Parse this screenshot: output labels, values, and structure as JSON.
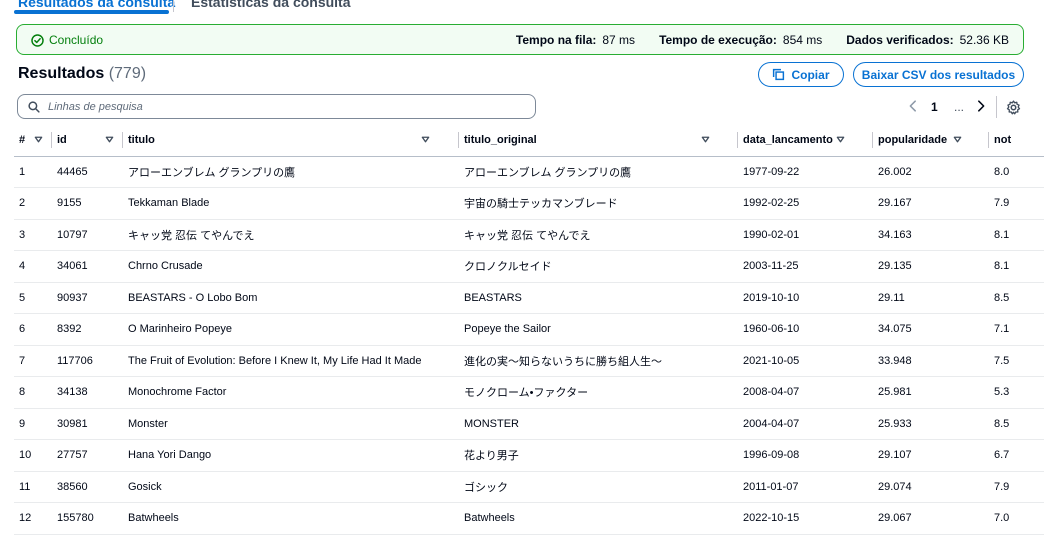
{
  "tabs": [
    {
      "label": "Resultados da consulta"
    },
    {
      "label": "Estatísticas da consulta"
    }
  ],
  "status": {
    "label": "Concluído",
    "queue_label": "Tempo na fila:",
    "queue_value": "87 ms",
    "exec_label": "Tempo de execução:",
    "exec_value": "854 ms",
    "data_label": "Dados verificados:",
    "data_value": "52.36 KB"
  },
  "results": {
    "title": "Resultados",
    "count": "(779)",
    "copy_label": "Copiar",
    "download_label": "Baixar CSV dos resultados"
  },
  "search": {
    "placeholder": "Linhas de pesquisa"
  },
  "pagination": {
    "current": "1",
    "ellipsis": "..."
  },
  "table": {
    "headers": [
      "#",
      "id",
      "titulo",
      "titulo_original",
      "data_lancamento",
      "popularidade",
      "not"
    ],
    "rows": [
      [
        "1",
        "44465",
        "アローエンブレム グランプリの鷹",
        "アローエンブレム グランプリの鷹",
        "1977-09-22",
        "26.002",
        "8.0"
      ],
      [
        "2",
        "9155",
        "Tekkaman Blade",
        "宇宙の騎士テッカマンブレード",
        "1992-02-25",
        "29.167",
        "7.9"
      ],
      [
        "3",
        "10797",
        "キャッ党 忍伝 てやんでえ",
        "キャッ党 忍伝 てやんでえ",
        "1990-02-01",
        "34.163",
        "8.1"
      ],
      [
        "4",
        "34061",
        "Chrno Crusade",
        "クロノクルセイド",
        "2003-11-25",
        "29.135",
        "8.1"
      ],
      [
        "5",
        "90937",
        "BEASTARS - O Lobo Bom",
        "BEASTARS",
        "2019-10-10",
        "29.11",
        "8.5"
      ],
      [
        "6",
        "8392",
        "O Marinheiro Popeye",
        "Popeye the Sailor",
        "1960-06-10",
        "34.075",
        "7.1"
      ],
      [
        "7",
        "117706",
        "The Fruit of Evolution: Before I Knew It, My Life Had It Made",
        "進化の実～知らないうちに勝ち組人生～",
        "2021-10-05",
        "33.948",
        "7.5"
      ],
      [
        "8",
        "34138",
        "Monochrome Factor",
        "モノクローム•ファクター",
        "2008-04-07",
        "25.981",
        "5.3"
      ],
      [
        "9",
        "30981",
        "Monster",
        "MONSTER",
        "2004-04-07",
        "25.933",
        "8.5"
      ],
      [
        "10",
        "27757",
        "Hana Yori Dango",
        "花より男子",
        "1996-09-08",
        "29.107",
        "6.7"
      ],
      [
        "11",
        "38560",
        "Gosick",
        "ゴシック",
        "2011-01-07",
        "29.074",
        "7.9"
      ],
      [
        "12",
        "155780",
        "Batwheels",
        "Batwheels",
        "2022-10-15",
        "29.067",
        "7.0"
      ]
    ]
  },
  "colors": {
    "accent": "#0972d3",
    "success": "#037f0c",
    "success_border": "#29ad32",
    "success_bg": "#f2fcf3"
  },
  "icons": [
    "check-circle-icon",
    "copy-icon",
    "search-icon",
    "chevron-left-icon",
    "chevron-right-icon",
    "gear-icon",
    "sort-caret-icon"
  ]
}
